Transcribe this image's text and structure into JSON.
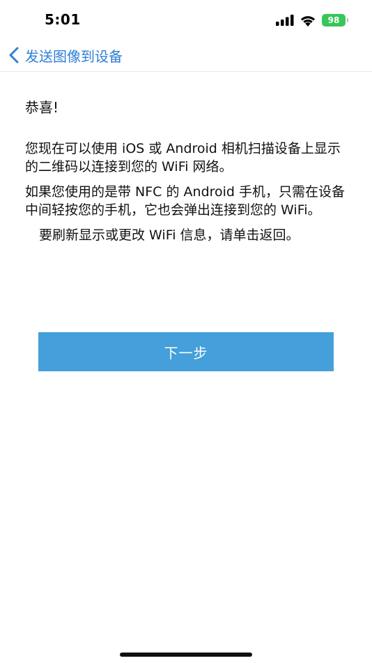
{
  "status_bar": {
    "time": "5:01",
    "battery_level": "98",
    "signal_icon": "cellular-signal-icon",
    "wifi_icon": "wifi-icon",
    "battery_icon": "battery-charging-icon",
    "battery_color": "#38c659"
  },
  "nav": {
    "back_label": "发送图像到设备",
    "back_icon": "chevron-left-icon",
    "accent_color": "#2f7fd6"
  },
  "content": {
    "title": "恭喜!",
    "paragraph_1": "您现在可以使用 iOS 或 Android 相机扫描设备上显示的二维码以连接到您的 WiFi 网络。",
    "paragraph_2": "如果您使用的是带 NFC 的 Android 手机，只需在设备中间轻按您的手机，它也会弹出连接到您的 WiFi。",
    "paragraph_3": "要刷新显示或更改 WiFi 信息，请单击返回。"
  },
  "actions": {
    "next_label": "下一步",
    "button_color": "#449fda"
  }
}
